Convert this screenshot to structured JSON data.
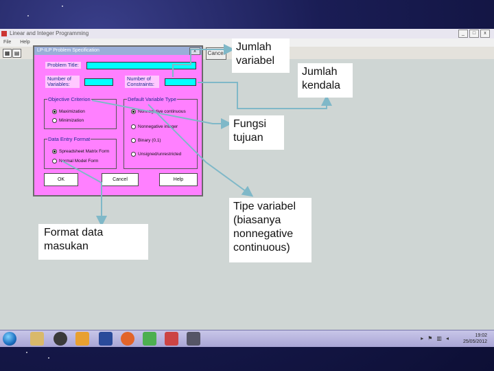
{
  "app_window": {
    "title": "Linear and Integer Programming",
    "menu": [
      "File",
      "Help"
    ],
    "partial_button_label": "Cancel",
    "window_buttons": [
      "_",
      "□",
      "x"
    ]
  },
  "dialog": {
    "title": "LP-ILP Problem Specification",
    "close_label": "x",
    "problem_title_label": "Problem Title:",
    "num_variables_label": "Number of Variables:",
    "num_constraints_label": "Number of Constraints:",
    "objective_group": {
      "title": "Objective Criterion",
      "options": [
        {
          "label": "Maximization",
          "selected": true
        },
        {
          "label": "Minimization",
          "selected": false
        }
      ]
    },
    "variable_type_group": {
      "title": "Default Variable Type",
      "options": [
        {
          "label": "Nonnegative continuous",
          "selected": true
        },
        {
          "label": "Nonnegative integer",
          "selected": false
        },
        {
          "label": "Binary (0,1)",
          "selected": false
        },
        {
          "label": "Unsigned/unrestricted",
          "selected": false
        }
      ]
    },
    "data_entry_group": {
      "title": "Data Entry Format",
      "options": [
        {
          "label": "Spreadsheet Matrix Form",
          "selected": true
        },
        {
          "label": "Normal Model Form",
          "selected": false
        }
      ]
    },
    "buttons": {
      "ok": "OK",
      "cancel": "Cancel",
      "help": "Help"
    }
  },
  "callouts": {
    "jumlah_variabel": "Jumlah variabel",
    "jumlah_kendala": "Jumlah kendala",
    "fungsi_tujuan": "Fungsi tujuan",
    "format_data": "Format data masukan",
    "tipe_variabel": "Tipe variabel (biasanya nonnegative continuous)"
  },
  "taskbar": {
    "time": "19:02",
    "date": "25/05/2012"
  },
  "colors": {
    "dialog_bg": "#ff80ff",
    "input_fill": "#00ffff",
    "arrow": "#7fb8c8",
    "slide_bg": "#1a1d55"
  }
}
